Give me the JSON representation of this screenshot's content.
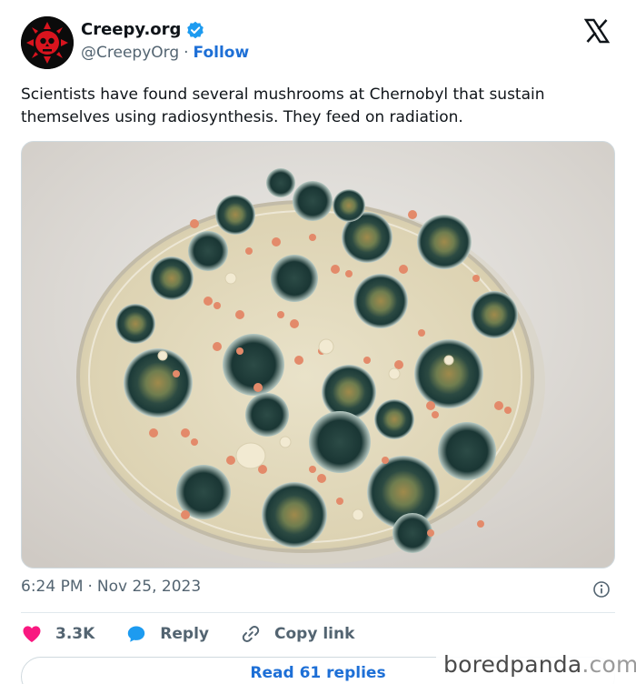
{
  "author": {
    "display_name": "Creepy.org",
    "handle": "@CreepyOrg",
    "separator": "·",
    "follow_label": "Follow",
    "verified": true
  },
  "tweet": {
    "text": "Scientists have found several mushrooms at Chernobyl that sustain themselves using radiosynthesis. They feed on radiation.",
    "time": "6:24 PM",
    "separator": "·",
    "date": "Nov 25, 2023"
  },
  "actions": {
    "likes_count": "3.3K",
    "reply_label": "Reply",
    "copy_link_label": "Copy link"
  },
  "read_replies_label": "Read 61 replies",
  "watermark": {
    "brand": "boredpanda",
    "suffix": ".com"
  },
  "icons": {
    "x_logo": "x-logo-icon",
    "verified": "verified-badge-icon",
    "info": "info-icon",
    "like": "heart-icon",
    "reply": "speech-bubble-icon",
    "copy_link": "link-icon"
  },
  "colors": {
    "accent": "#1d6fd6",
    "heart": "#f91880",
    "secondary_text": "#536471",
    "verified": "#1d9bf0"
  }
}
